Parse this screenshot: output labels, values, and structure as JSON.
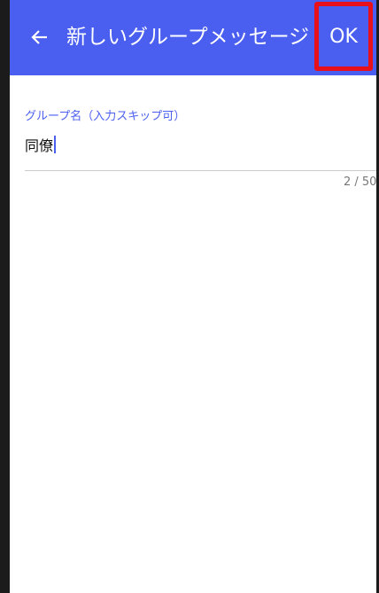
{
  "appbar": {
    "back_icon": "back-arrow-icon",
    "title": "新しいグループメッセージ",
    "ok_label": "OK",
    "color": "#4a5ff0",
    "highlight_color": "#e8111b"
  },
  "group_name_field": {
    "label": "グループ名（入力スキップ可）",
    "value": "同僚",
    "counter": "2 / 50"
  }
}
